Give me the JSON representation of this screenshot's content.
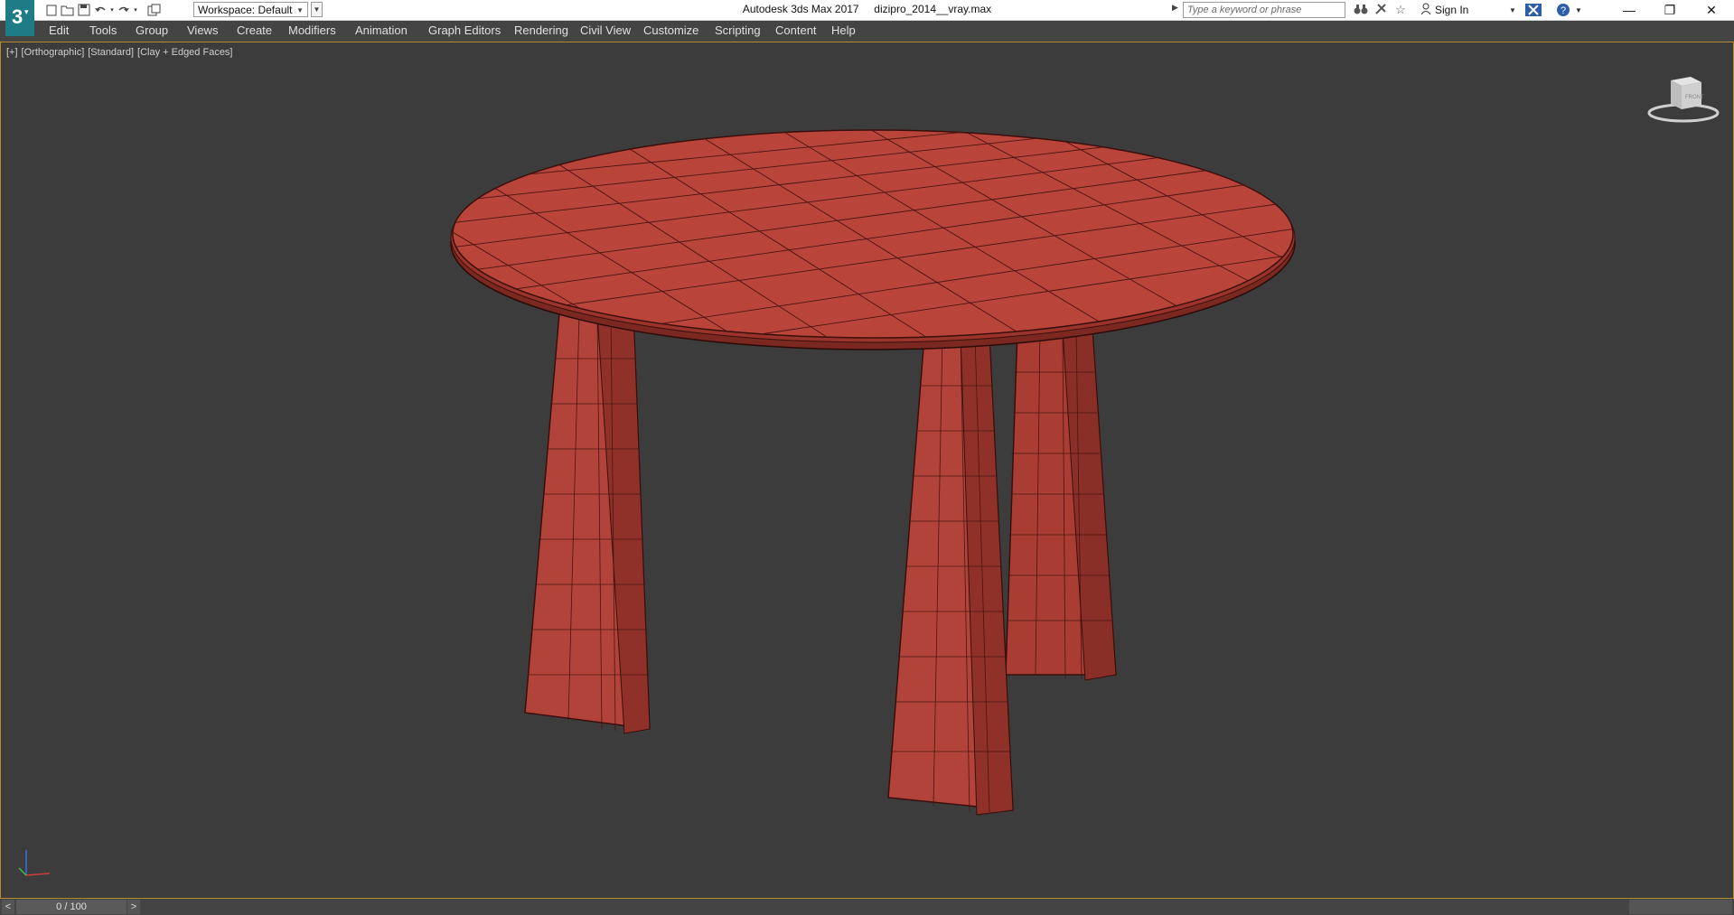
{
  "titlebar": {
    "app_title": "Autodesk 3ds Max 2017",
    "file_name": "dizipro_2014__vray.max",
    "workspace_label": "Workspace: Default",
    "search_placeholder": "Type a keyword or phrase",
    "sign_in_label": "Sign In",
    "icons": [
      "new-file-icon",
      "open-file-icon",
      "save-icon",
      "undo-icon",
      "redo-icon",
      "project-folder-icon",
      "binoculars-icon",
      "star-tools-icon",
      "favorites-star-icon",
      "user-icon",
      "exchange-x-icon",
      "help-icon"
    ]
  },
  "menu": {
    "items": [
      "Edit",
      "Tools",
      "Group",
      "Views",
      "Create",
      "Modifiers",
      "Animation",
      "Graph Editors",
      "Rendering",
      "Civil View",
      "Customize",
      "Scripting",
      "Content",
      "Help"
    ]
  },
  "viewport": {
    "label_plus": "[+]",
    "label_view": "[Orthographic]",
    "label_shading_std": "[Standard]",
    "label_shading_mode": "[Clay + Edged Faces]",
    "viewcube_face": "FRONT"
  },
  "timeline": {
    "frame_readout": "0 / 100",
    "prev_label": "<",
    "next_label": ">"
  },
  "colors": {
    "accent_border": "#b28d2a",
    "viewport_bg": "#3c3c3c",
    "clay": "#b8443a"
  }
}
